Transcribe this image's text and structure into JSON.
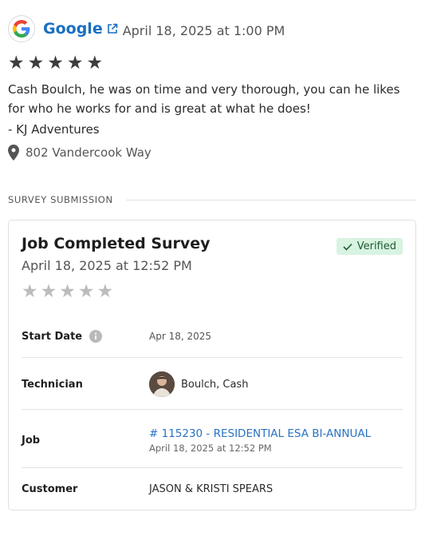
{
  "review": {
    "source_name": "Google",
    "date": "April 18, 2025 at 1:00 PM",
    "rating": 5,
    "stars": [
      "★",
      "★",
      "★",
      "★",
      "★"
    ],
    "text": "Cash Boulch, he was on time and very thorough, you can he likes for who he works for and is great at what he does!",
    "signature": "- KJ Adventures",
    "location": "802 Vandercook Way"
  },
  "section": {
    "label": "SURVEY SUBMISSION"
  },
  "survey": {
    "title": "Job Completed Survey",
    "date": "April 18, 2025 at 12:52 PM",
    "badge": "Verified",
    "rating": 0,
    "stars": [
      "★",
      "★",
      "★",
      "★",
      "★"
    ],
    "fields": {
      "start_date": {
        "label": "Start Date",
        "value": "Apr 18, 2025"
      },
      "technician": {
        "label": "Technician",
        "value": "Boulch, Cash"
      },
      "job": {
        "label": "Job",
        "link": "# 115230 - RESIDENTIAL ESA BI-ANNUAL",
        "sub": "April 18, 2025 at 12:52 PM"
      },
      "customer": {
        "label": "Customer",
        "value": "JASON & KRISTI SPEARS"
      }
    }
  },
  "colors": {
    "link": "#1a6fc2",
    "badge_bg": "#d8f3e1",
    "badge_text": "#1f5a33",
    "star_filled": "#3d3d3d",
    "star_empty": "#bcbcbc"
  },
  "icons": {
    "source_logo": "google-logo-icon",
    "external_link": "external-link-icon",
    "location": "map-pin-icon",
    "verified": "check-icon",
    "info": "info-icon"
  }
}
